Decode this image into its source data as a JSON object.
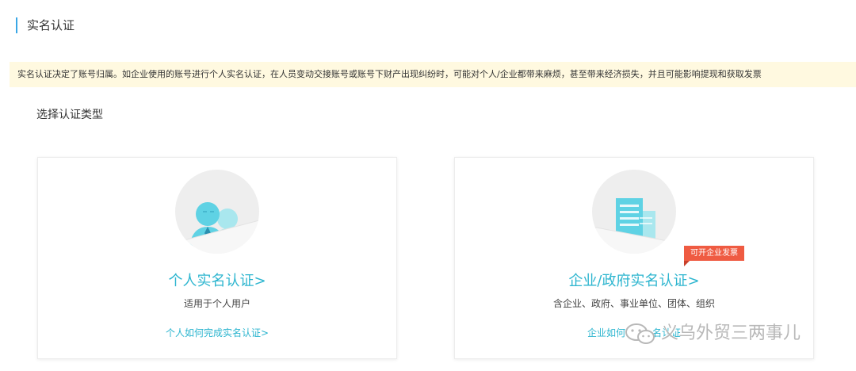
{
  "page": {
    "title": "实名认证",
    "notice": "实名认证决定了账号归属。如企业使用的账号进行个人实名认证，在人员变动交接账号或账号下财产出现纠纷时，可能对个人/企业都带来麻烦，甚至带来经济损失，并且可能影响提现和获取发票",
    "section_heading": "选择认证类型"
  },
  "cards": {
    "personal": {
      "title": "个人实名认证>",
      "desc": "适用于个人用户",
      "link": "个人如何完成实名认证>",
      "icon": "person-pair-icon"
    },
    "enterprise": {
      "title": "企业/政府实名认证>",
      "desc": "含企业、政府、事业单位、团体、组织",
      "link": "企业如何",
      "link_tail": "名认证",
      "badge": "可开企业发票",
      "icon": "building-icon"
    }
  },
  "watermark": {
    "text": "义乌外贸三两事儿",
    "icon": "wechat-icon"
  },
  "colors": {
    "accent": "#2cb5cf",
    "title_bar": "#3aa7e6",
    "notice_bg": "#fff9e0",
    "badge": "#ef5b42"
  }
}
